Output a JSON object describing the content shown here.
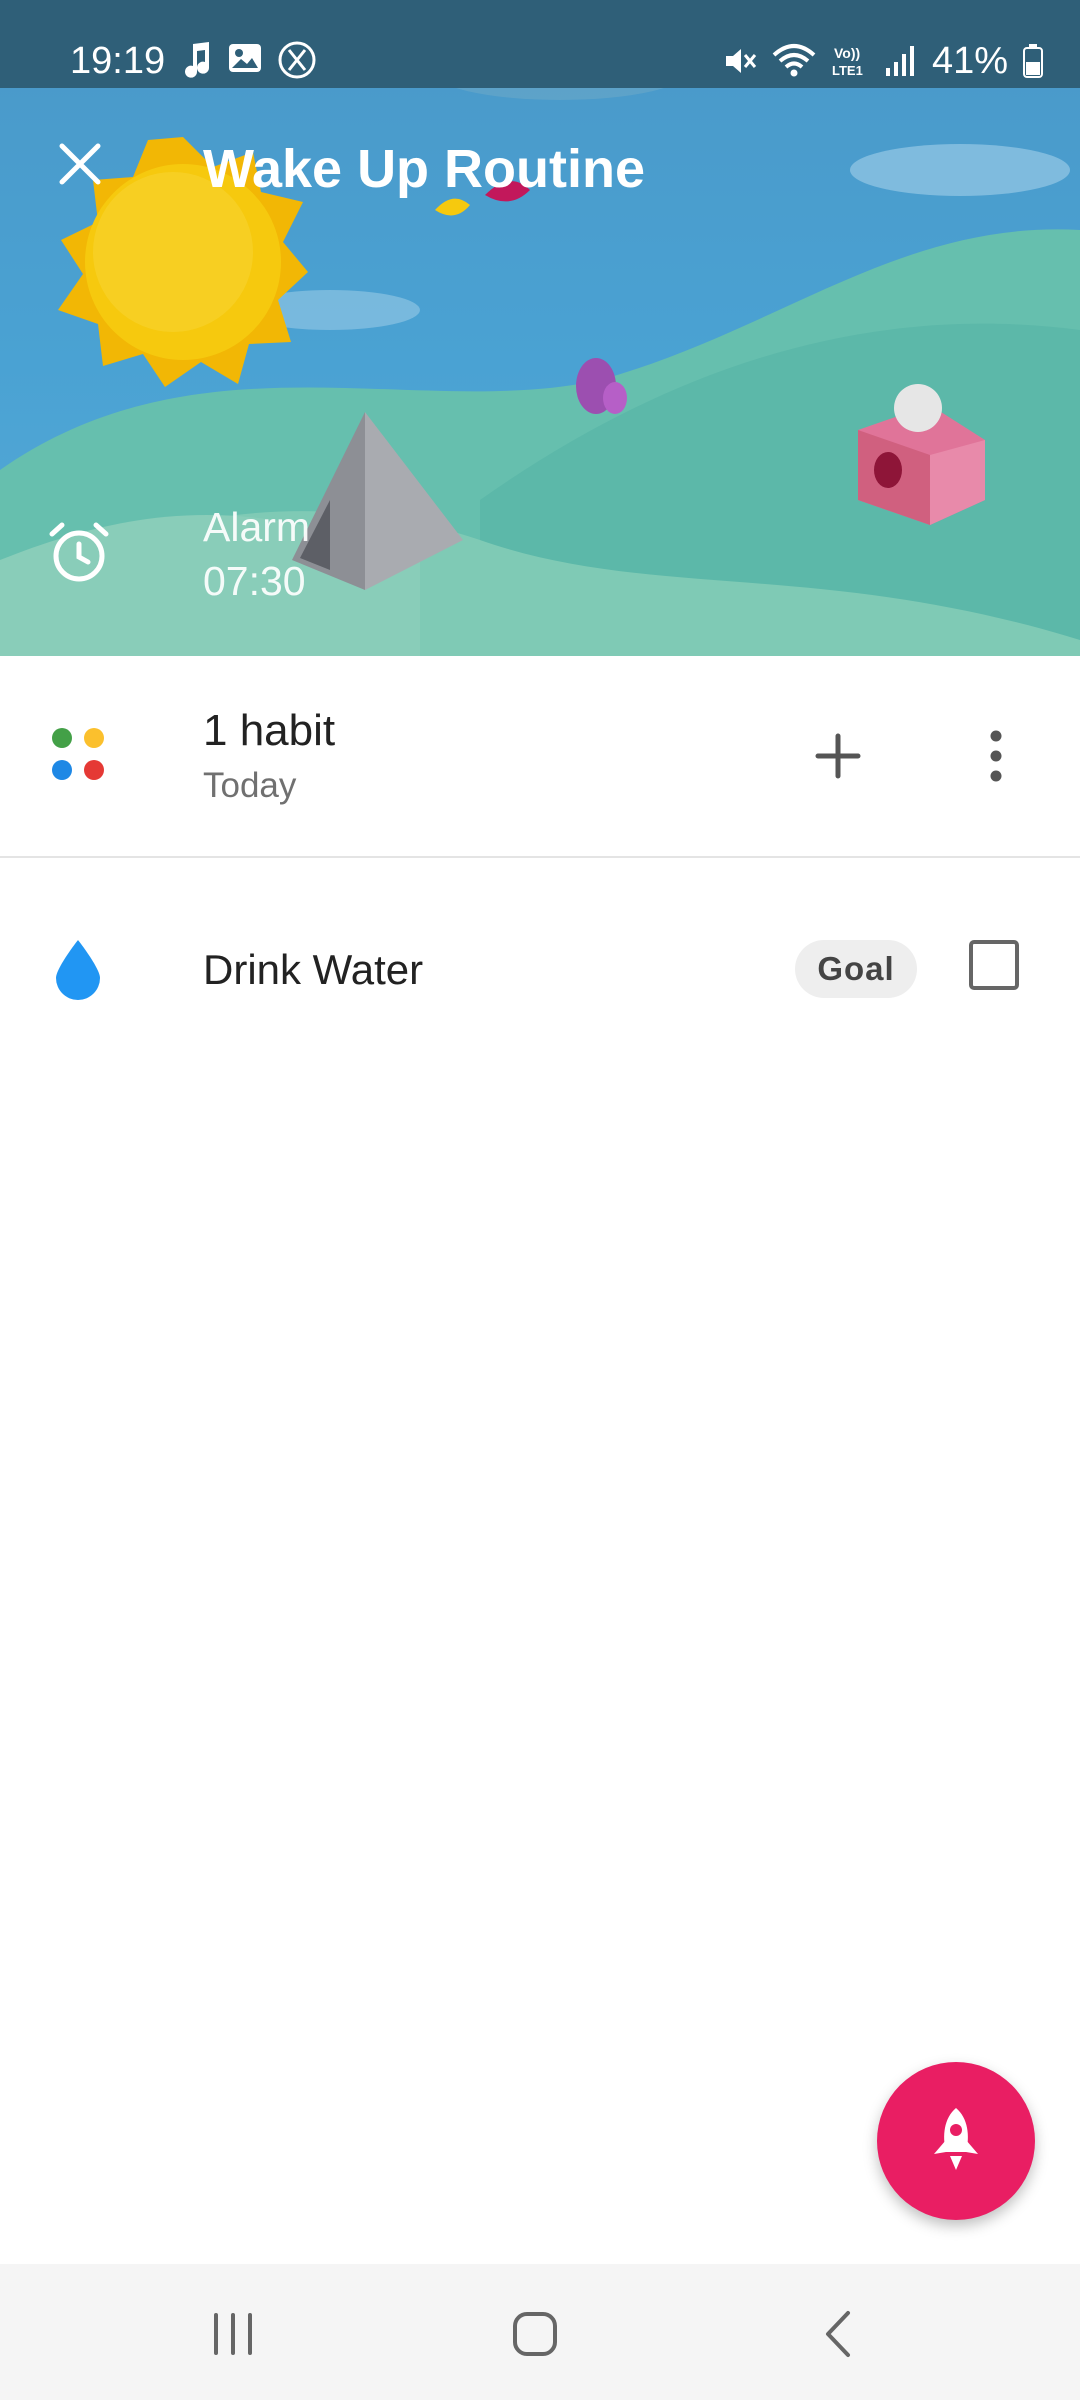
{
  "status_bar": {
    "time": "19:19",
    "battery": "41%",
    "left_icons": [
      "music-note-icon",
      "image-icon",
      "x-logo-icon"
    ],
    "right_icons": [
      "mute-icon",
      "wifi-icon",
      "volte-icon",
      "signal-icon",
      "battery-icon"
    ]
  },
  "header": {
    "title": "Wake Up Routine",
    "close_icon": "close-icon",
    "alarm_label": "Alarm",
    "alarm_time": "07:30",
    "alarm_icon": "alarm-clock-icon"
  },
  "summary": {
    "title": "1 habit",
    "subtitle": "Today",
    "dot_colors": [
      "#43a047",
      "#fbc02d",
      "#1e88e5",
      "#e53935"
    ],
    "add_icon": "plus-icon",
    "more_icon": "more-vert-icon"
  },
  "habits": [
    {
      "name": "Drink Water",
      "icon": "water-drop-icon",
      "icon_color": "#2196f3",
      "badge": "Goal",
      "checked": false
    }
  ],
  "fab": {
    "icon": "rocket-icon",
    "color": "#e91e63"
  },
  "nav": [
    "recents-icon",
    "home-icon",
    "back-icon"
  ]
}
